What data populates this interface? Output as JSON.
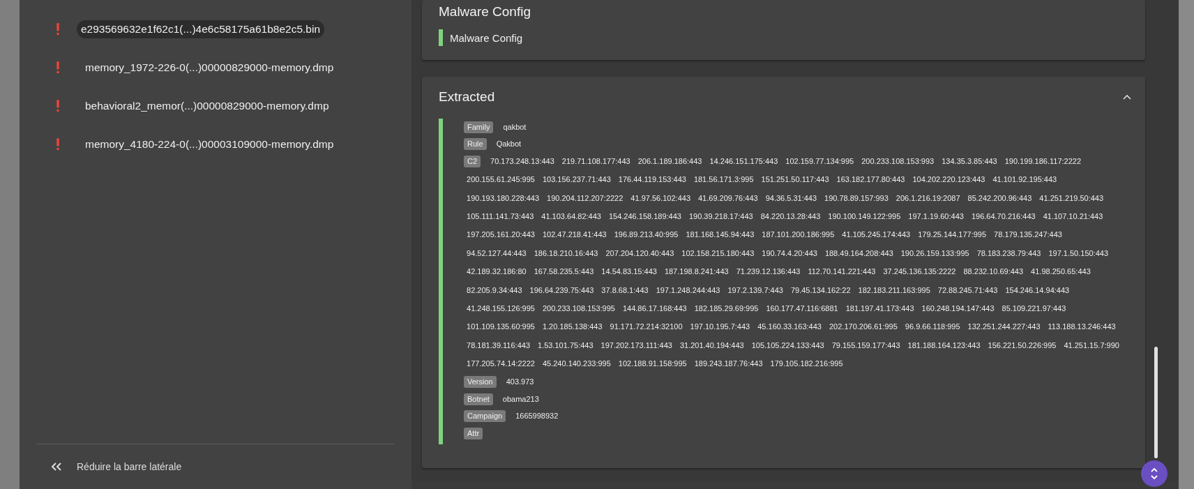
{
  "sidebar": {
    "items": [
      {
        "label": "e293569632e1f62c1(...)4e6c58175a61b8e2c5.bin",
        "selected": true
      },
      {
        "label": "memory_1972-226-0(...)00000829000-memory.dmp",
        "selected": false
      },
      {
        "label": "behavioral2_memor(...)00000829000-memory.dmp",
        "selected": false
      },
      {
        "label": "memory_4180-224-0(...)00003109000-memory.dmp",
        "selected": false
      }
    ],
    "collapse_label": "Réduire la barre latérale"
  },
  "config_card": {
    "title": "Malware Config",
    "entry": "Malware Config"
  },
  "extracted_card": {
    "title": "Extracted",
    "expanded": true,
    "fields": [
      {
        "key": "Family",
        "value": "qakbot"
      },
      {
        "key": "Rule",
        "value": "Qakbot"
      },
      {
        "key": "C2",
        "lines": [
          [
            "70.173.248.13:443",
            "219.71.108.177:443",
            "206.1.189.186:443",
            "14.246.151.175:443",
            "102.159.77.134:995",
            "200.233.108.153:993",
            "134.35.3.85:443",
            "190.199.186.117:2222"
          ],
          [
            "200.155.61.245:995",
            "103.156.237.71:443",
            "176.44.119.153:443",
            "181.56.171.3:995",
            "151.251.50.117:443",
            "163.182.177.80:443",
            "104.202.220.123:443",
            "41.101.92.195:443"
          ],
          [
            "190.193.180.228:443",
            "190.204.112.207:2222",
            "41.97.56.102:443",
            "41.69.209.76:443",
            "94.36.5.31:443",
            "190.78.89.157:993",
            "206.1.216.19:2087",
            "85.242.200.96:443",
            "41.251.219.50:443"
          ],
          [
            "105.111.141.73:443",
            "41.103.64.82:443",
            "154.246.158.189:443",
            "190.39.218.17:443",
            "84.220.13.28:443",
            "190.100.149.122:995",
            "197.1.19.60:443",
            "196.64.70.216:443",
            "41.107.10.21:443"
          ],
          [
            "197.205.161.20:443",
            "102.47.218.41:443",
            "196.89.213.40:995",
            "181.168.145.94:443",
            "187.101.200.186:995",
            "41.105.245.174:443",
            "179.25.144.177:995",
            "78.179.135.247:443"
          ],
          [
            "94.52.127.44:443",
            "186.18.210.16:443",
            "207.204.120.40:443",
            "102.158.215.180:443",
            "190.74.4.20:443",
            "188.49.164.208:443",
            "190.26.159.133:995",
            "78.183.238.79:443",
            "197.1.50.150:443"
          ],
          [
            "42.189.32.186:80",
            "167.58.235.5:443",
            "14.54.83.15:443",
            "187.198.8.241:443",
            "71.239.12.136:443",
            "112.70.141.221:443",
            "37.245.136.135:2222",
            "88.232.10.69:443",
            "41.98.250.65:443"
          ],
          [
            "82.205.9.34:443",
            "196.64.239.75:443",
            "37.8.68.1:443",
            "197.1.248.244:443",
            "197.2.139.7:443",
            "79.45.134.162:22",
            "182.183.211.163:995",
            "72.88.245.71:443",
            "154.246.14.94:443"
          ],
          [
            "41.248.155.126:995",
            "200.233.108.153:995",
            "144.86.17.168:443",
            "182.185.29.69:995",
            "160.177.47.116:6881",
            "181.197.41.173:443",
            "160.248.194.147:443",
            "85.109.221.97:443"
          ],
          [
            "101.109.135.60:995",
            "1.20.185.138:443",
            "91.171.72.214:32100",
            "197.10.195.7:443",
            "45.160.33.163:443",
            "202.170.206.61:995",
            "96.9.66.118:995",
            "132.251.244.227:443",
            "113.188.13.246:443"
          ],
          [
            "78.181.39.116:443",
            "1.53.101.75:443",
            "197.202.173.111:443",
            "31.201.40.194:443",
            "105.105.224.133:443",
            "79.155.159.177:443",
            "181.188.164.123:443",
            "156.221.50.226:995",
            "41.251.15.7:990"
          ],
          [
            "177.205.74.14:2222",
            "45.240.140.233:995",
            "102.188.91.158:995",
            "189.243.187.76:443",
            "179.105.182.216:995"
          ]
        ]
      },
      {
        "key": "Version",
        "value": "403.973"
      },
      {
        "key": "Botnet",
        "value": "obama213"
      },
      {
        "key": "Campaign",
        "value": "1665998932"
      },
      {
        "key": "Attr"
      }
    ]
  }
}
